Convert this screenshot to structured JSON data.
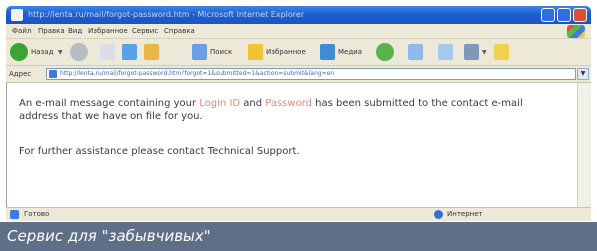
{
  "window": {
    "title": "http://lenta.ru/mail/forgot-password.htm - Microsoft Internet Explorer",
    "title_color": "#1d5fd0"
  },
  "menu": {
    "items": [
      "Файл",
      "Правка",
      "Вид",
      "Избранное",
      "Сервис",
      "Справка"
    ]
  },
  "toolbar": {
    "back_label": "Назад",
    "search_label": "Поиск",
    "favorites_label": "Избранное",
    "media_label": "Медиа"
  },
  "address": {
    "label": "Адрес",
    "url": "http://lenta.ru/mail/forgot-password.htm?forgot=1&submitted=1&action=submit&lang=en"
  },
  "content": {
    "p1_before": "An e-mail message containing your ",
    "p1_hl1": "Login ID",
    "p1_mid": " and ",
    "p1_hl2": "Password",
    "p1_after": " has been submitted to the contact e-mail",
    "p2": "address that we have on file for you.",
    "p3": "For further assistance please contact Technical Support."
  },
  "status": {
    "left": "Готово",
    "right": "Интернет"
  },
  "caption": {
    "text": "Сервис для \"забывчивых\""
  }
}
